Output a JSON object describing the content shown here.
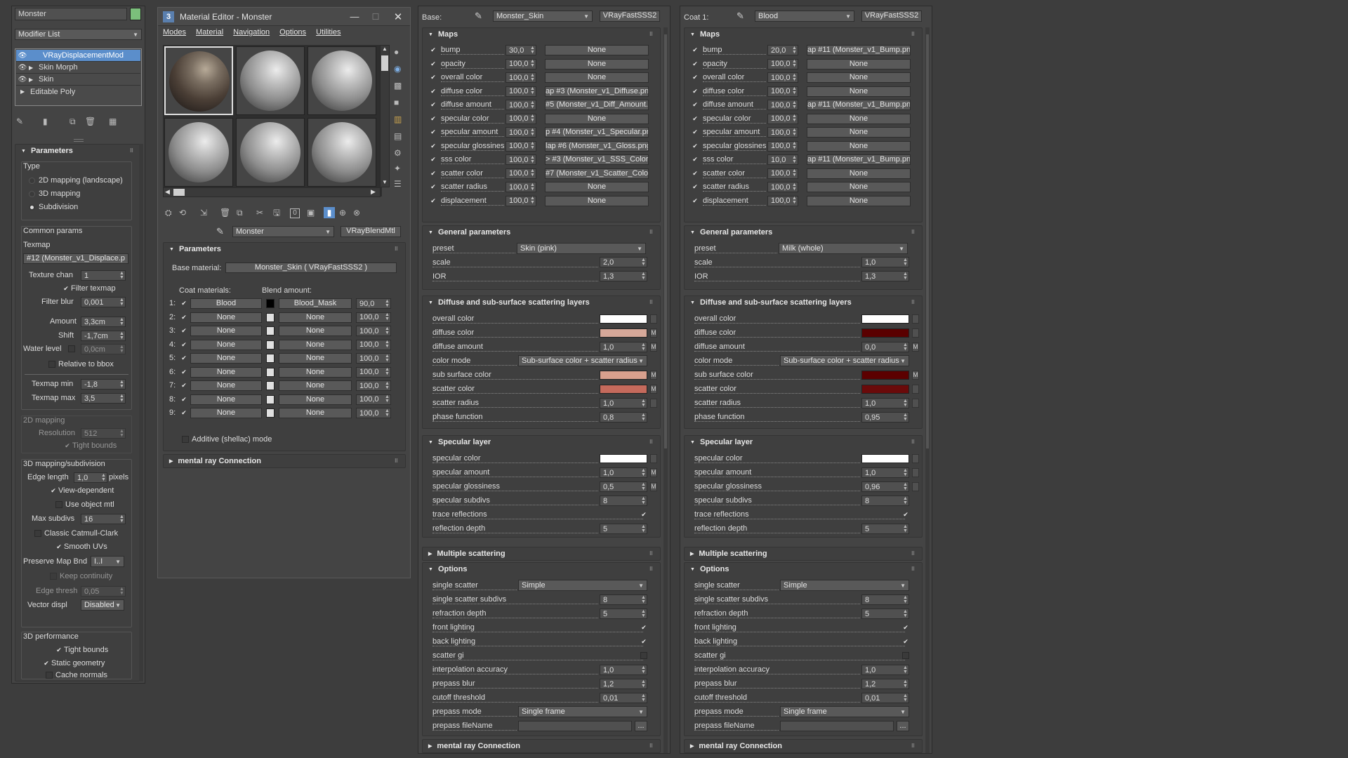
{
  "modifier_panel": {
    "object_name": "Monster",
    "object_color": "#7bbf7b",
    "modifier_list_label": "Modifier List",
    "stack": [
      {
        "name": "VRayDisplacementMod",
        "selected": true,
        "eye": true,
        "arrow": false
      },
      {
        "name": "Skin Morph",
        "selected": false,
        "eye": true,
        "arrow": true
      },
      {
        "name": "Skin",
        "selected": false,
        "eye": true,
        "arrow": true
      },
      {
        "name": "Editable Poly",
        "selected": false,
        "eye": false,
        "arrow": true
      }
    ],
    "params_title": "Parameters",
    "type_label": "Type",
    "type_options": [
      "2D mapping (landscape)",
      "3D mapping",
      "Subdivision"
    ],
    "selected_type": "Subdivision",
    "common_params": "Common params",
    "texmap_label": "Texmap",
    "texmap_value": "#12 (Monster_v1_Displace.p",
    "texture_chan_label": "Texture chan",
    "texture_chan": "1",
    "filter_texmap": "Filter texmap",
    "filter_blur_label": "Filter blur",
    "filter_blur": "0,001",
    "amount_label": "Amount",
    "amount": "3,3cm",
    "shift_label": "Shift",
    "shift": "-1,7cm",
    "water_level_label": "Water level",
    "water_level": "0,0cm",
    "relative_bbox": "Relative to bbox",
    "texmap_min_label": "Texmap min",
    "texmap_min": "-1,8",
    "texmap_max_label": "Texmap max",
    "texmap_max": "3,5",
    "mapping2d": "2D mapping",
    "resolution_label": "Resolution",
    "resolution": "512",
    "tight_bounds": "Tight bounds",
    "mapping3d": "3D mapping/subdivision",
    "edge_length_label": "Edge length",
    "edge_length": "1,0",
    "pixels": "pixels",
    "view_dependent": "View-dependent",
    "use_object_mtl": "Use object mtl",
    "max_subdivs_label": "Max subdivs",
    "max_subdivs": "16",
    "classic_catmull": "Classic Catmull-Clark",
    "smooth_uvs": "Smooth UVs",
    "preserve_map_label": "Preserve Map Bnd",
    "preserve_map": "I..I",
    "keep_continuity": "Keep continuity",
    "edge_thresh_label": "Edge thresh",
    "edge_thresh": "0,05",
    "vector_displ_label": "Vector displ",
    "vector_displ": "Disabled",
    "perf_label": "3D performance",
    "perf_tight": "Tight bounds",
    "static_geo": "Static geometry",
    "cache_normals": "Cache normals"
  },
  "material_editor": {
    "title": "Material Editor - Monster",
    "app_icon": "3",
    "menu": [
      "Modes",
      "Material",
      "Navigation",
      "Options",
      "Utilities"
    ],
    "material_name": "Monster",
    "material_type": "VRayBlendMtl",
    "params_title": "Parameters",
    "base_material_label": "Base material:",
    "base_material": "Monster_Skin  ( VRayFastSSS2 )",
    "coat_materials_label": "Coat materials:",
    "blend_amount_label": "Blend amount:",
    "coats": [
      {
        "num": "1:",
        "coat": "Blood",
        "blend": "Blood_Mask",
        "amount": "90,0",
        "swatch": "#000000"
      },
      {
        "num": "2:",
        "coat": "None",
        "blend": "None",
        "amount": "100,0",
        "swatch": "#e0e0e0"
      },
      {
        "num": "3:",
        "coat": "None",
        "blend": "None",
        "amount": "100,0",
        "swatch": "#e0e0e0"
      },
      {
        "num": "4:",
        "coat": "None",
        "blend": "None",
        "amount": "100,0",
        "swatch": "#e0e0e0"
      },
      {
        "num": "5:",
        "coat": "None",
        "blend": "None",
        "amount": "100,0",
        "swatch": "#e0e0e0"
      },
      {
        "num": "6:",
        "coat": "None",
        "blend": "None",
        "amount": "100,0",
        "swatch": "#e0e0e0"
      },
      {
        "num": "7:",
        "coat": "None",
        "blend": "None",
        "amount": "100,0",
        "swatch": "#e0e0e0"
      },
      {
        "num": "8:",
        "coat": "None",
        "blend": "None",
        "amount": "100,0",
        "swatch": "#e0e0e0"
      },
      {
        "num": "9:",
        "coat": "None",
        "blend": "None",
        "amount": "100,0",
        "swatch": "#e0e0e0"
      }
    ],
    "additive_mode": "Additive (shellac) mode",
    "mental_ray": "mental ray Connection"
  },
  "panels": [
    {
      "slot_label": "Base:",
      "material_name": "Monster_Skin",
      "material_type": "VRayFastSSS2",
      "maps_title": "Maps",
      "maps": [
        {
          "label": "bump",
          "value": "30,0",
          "map": "None"
        },
        {
          "label": "opacity",
          "value": "100,0",
          "map": "None"
        },
        {
          "label": "overall color",
          "value": "100,0",
          "map": "None"
        },
        {
          "label": "diffuse color",
          "value": "100,0",
          "map": "ap #3 (Monster_v1_Diffuse.pn"
        },
        {
          "label": "diffuse amount",
          "value": "100,0",
          "map": "#5 (Monster_v1_Diff_Amount."
        },
        {
          "label": "specular color",
          "value": "100,0",
          "map": "None"
        },
        {
          "label": "specular amount",
          "value": "100,0",
          "map": "p #4 (Monster_v1_Specular.pr"
        },
        {
          "label": "specular glossiness",
          "value": "100,0",
          "map": "lap #6 (Monster_v1_Gloss.png"
        },
        {
          "label": "sss color",
          "value": "100,0",
          "map": "> #3 (Monster_v1_SSS_Color.p"
        },
        {
          "label": "scatter color",
          "value": "100,0",
          "map": "#7 (Monster_v1_Scatter_Color."
        },
        {
          "label": "scatter radius",
          "value": "100,0",
          "map": "None"
        },
        {
          "label": "displacement",
          "value": "100,0",
          "map": "None"
        }
      ],
      "general_title": "General parameters",
      "preset_label": "preset",
      "preset": "Skin (pink)",
      "scale_label": "scale",
      "scale": "2,0",
      "ior_label": "IOR",
      "ior": "1,3",
      "diffuse_title": "Diffuse and sub-surface scattering layers",
      "overall_color_label": "overall color",
      "overall_color": "#ffffff",
      "diffuse_color_label": "diffuse color",
      "diffuse_color": "#d6a899",
      "diffuse_amount_label": "diffuse amount",
      "diffuse_amount": "1,0",
      "color_mode_label": "color mode",
      "color_mode": "Sub-surface color + scatter radius",
      "sub_surface_color_label": "sub surface color",
      "sub_surface_color": "#d9a08d",
      "scatter_color_label": "scatter color",
      "scatter_color": "#c56a5c",
      "scatter_radius_label": "scatter radius",
      "scatter_radius": "1,0",
      "phase_function_label": "phase function",
      "phase_function": "0,8",
      "specular_title": "Specular layer",
      "specular_color_label": "specular color",
      "specular_color": "#ffffff",
      "specular_amount_label": "specular amount",
      "specular_amount": "1,0",
      "specular_gloss_label": "specular glossiness",
      "specular_gloss": "0,5",
      "specular_subdivs_label": "specular subdivs",
      "specular_subdivs": "8",
      "trace_reflections_label": "trace reflections",
      "reflection_depth_label": "reflection depth",
      "reflection_depth": "5",
      "multiple_title": "Multiple scattering",
      "options_title": "Options",
      "single_scatter_label": "single scatter",
      "single_scatter": "Simple",
      "single_subdivs_label": "single scatter subdivs",
      "single_subdivs": "8",
      "refraction_depth_label": "refraction depth",
      "refraction_depth": "5",
      "front_lighting_label": "front lighting",
      "back_lighting_label": "back lighting",
      "scatter_gi_label": "scatter gi",
      "interp_label": "interpolation accuracy",
      "interp": "1,0",
      "prepass_blur_label": "prepass blur",
      "prepass_blur": "1,2",
      "cutoff_label": "cutoff threshold",
      "cutoff": "0,01",
      "prepass_mode_label": "prepass mode",
      "prepass_mode": "Single frame",
      "prepass_file_label": "prepass fileName",
      "browse": "...",
      "mental_ray": "mental ray Connection"
    },
    {
      "slot_label": "Coat 1:",
      "material_name": "Blood",
      "material_type": "VRayFastSSS2",
      "maps_title": "Maps",
      "maps": [
        {
          "label": "bump",
          "value": "20,0",
          "map": "ap #11 (Monster_v1_Bump.png"
        },
        {
          "label": "opacity",
          "value": "100,0",
          "map": "None"
        },
        {
          "label": "overall color",
          "value": "100,0",
          "map": "None"
        },
        {
          "label": "diffuse color",
          "value": "100,0",
          "map": "None"
        },
        {
          "label": "diffuse amount",
          "value": "100,0",
          "map": "ap #11 (Monster_v1_Bump.png"
        },
        {
          "label": "specular color",
          "value": "100,0",
          "map": "None"
        },
        {
          "label": "specular amount",
          "value": "100,0",
          "map": "None"
        },
        {
          "label": "specular glossiness",
          "value": "100,0",
          "map": "None"
        },
        {
          "label": "sss color",
          "value": "10,0",
          "map": "ap #11 (Monster_v1_Bump.png"
        },
        {
          "label": "scatter color",
          "value": "100,0",
          "map": "None"
        },
        {
          "label": "scatter radius",
          "value": "100,0",
          "map": "None"
        },
        {
          "label": "displacement",
          "value": "100,0",
          "map": "None"
        }
      ],
      "general_title": "General parameters",
      "preset_label": "preset",
      "preset": "Milk (whole)",
      "scale_label": "scale",
      "scale": "1,0",
      "ior_label": "IOR",
      "ior": "1,3",
      "diffuse_title": "Diffuse and sub-surface scattering layers",
      "overall_color_label": "overall color",
      "overall_color": "#ffffff",
      "diffuse_color_label": "diffuse color",
      "diffuse_color": "#5a0000",
      "diffuse_amount_label": "diffuse amount",
      "diffuse_amount": "0,0",
      "color_mode_label": "color mode",
      "color_mode": "Sub-surface color + scatter radius",
      "sub_surface_color_label": "sub surface color",
      "sub_surface_color": "#5c0000",
      "scatter_color_label": "scatter color",
      "scatter_color": "#6a0a0a",
      "scatter_radius_label": "scatter radius",
      "scatter_radius": "1,0",
      "phase_function_label": "phase function",
      "phase_function": "0,95",
      "specular_title": "Specular layer",
      "specular_color_label": "specular color",
      "specular_color": "#ffffff",
      "specular_amount_label": "specular amount",
      "specular_amount": "1,0",
      "specular_gloss_label": "specular glossiness",
      "specular_gloss": "0,96",
      "specular_subdivs_label": "specular subdivs",
      "specular_subdivs": "8",
      "trace_reflections_label": "trace reflections",
      "reflection_depth_label": "reflection depth",
      "reflection_depth": "5",
      "multiple_title": "Multiple scattering",
      "options_title": "Options",
      "single_scatter_label": "single scatter",
      "single_scatter": "Simple",
      "single_subdivs_label": "single scatter subdivs",
      "single_subdivs": "8",
      "refraction_depth_label": "refraction depth",
      "refraction_depth": "5",
      "front_lighting_label": "front lighting",
      "back_lighting_label": "back lighting",
      "scatter_gi_label": "scatter gi",
      "interp_label": "interpolation accuracy",
      "interp": "1,0",
      "prepass_blur_label": "prepass blur",
      "prepass_blur": "1,2",
      "cutoff_label": "cutoff threshold",
      "cutoff": "0,01",
      "prepass_mode_label": "prepass mode",
      "prepass_mode": "Single frame",
      "prepass_file_label": "prepass fileName",
      "browse": "...",
      "mental_ray": "mental ray Connection"
    }
  ]
}
